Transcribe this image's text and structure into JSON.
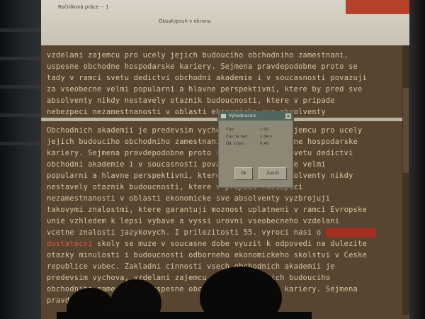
{
  "app": {
    "title": "Ročníková práce -- 1",
    "subtitle": "Obsah/pruh v ekranu"
  },
  "upper_text": [
    "vzdelani zajemcu pro ucely jejich budouciho obchodniho zamestnani,",
    "uspesne obchodne hospodarske kariery. Sejmena pravdepodobne proto se",
    "tady v ramci svetu dedictvi obchodni akademie i v soucasnosti povazuji",
    "za vseobecne velmi popularni a hlavne perspektivni, ktere by pred sve",
    "absolventy nikdy nestavely otaznik budoucnosti, ktere v pripade",
    "nebezpeci nezamestnanosti v oblasti ekonomicke sve absolventy"
  ],
  "lower_text": [
    "Obchodnich akademii je predevsim vychova a vzdelani zajemcu pro ucely",
    "jejich budouciho obchodniho zamestnani, uspesne obchodne hospodarske",
    "kariery. Sejmena pravdepodobne proto se tady v ramci svetu dedictvi",
    "obchodni akademie i v soucasnosti povazuji za vseobecne velmi",
    "popularni a hlavne perspektivni, ktere by pred sve absolventy nikdy",
    "nestavely otaznik budoucnosti, ktere v pripade nebezpeci",
    "nezamestnanosti v oblasti ekonomicke sve absolventy vyzbrojuji",
    "takovymi znalostmi, ktere garantuji moznost uplatneni v ramci Evropske",
    "unie vzhledem k lepsi vybave a vyssi urovni vseobecneho vzdelani",
    "vcetne znalosti jazykovych. I prilezitosti 55. vyroci nasi o",
    "skoly se muze v soucasne dobe vyuzit k odpovedi na dulezite",
    "otazky minulosti i budoucnosti odborneho ekonomickeho skolstvi v Ceske",
    "republice vubec. Zakladni cinnosti vsech obchodnich akademii je",
    "predevsim vychova, vzdelani zajemcu pro ucely jejich budouciho",
    "obchodniho zamestnani, uspesne obchodne hospodarske kariery. Sejmena",
    "pravde"
  ],
  "highlighted_word": "dostatecni",
  "dialog": {
    "title": "Vyhodnoceni",
    "rows": [
      {
        "label": "Čas:",
        "value": "1:00"
      },
      {
        "label": "Čas na řad. :",
        "value": "1:04 s"
      },
      {
        "label": "Úd. Chyb:",
        "value": "0.45"
      }
    ],
    "ok": "Ok",
    "cancel": "Zavrit"
  },
  "colors": {
    "screen_bg": "#574431",
    "text": "#d8c8a3",
    "accent": "#b6422a",
    "dialog_title": "#51665e"
  }
}
